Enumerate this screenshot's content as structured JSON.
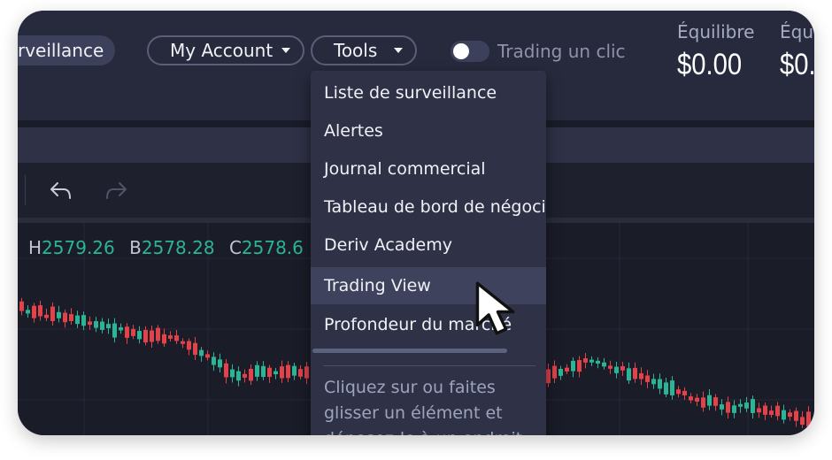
{
  "header": {
    "watchlist_label": "rveillance",
    "account_label": "My Account",
    "tools_label": "Tools",
    "toggle_label": "Trading un clic",
    "balances": [
      {
        "label": "Équilibre",
        "value": "$0.00"
      },
      {
        "label": "Équ",
        "value": "$0."
      }
    ]
  },
  "tools_menu": {
    "items": [
      {
        "label": "Liste de surveillance"
      },
      {
        "label": "Alertes"
      },
      {
        "label": "Journal commercial"
      },
      {
        "label": "Tableau de bord de négocia"
      },
      {
        "label": "Deriv Academy"
      },
      {
        "label": "Trading View"
      },
      {
        "label": "Profondeur du marché"
      }
    ],
    "hover_index": 5,
    "hint": "Cliquez sur ou faites glisser un élément et déposez-le à un endroit"
  },
  "chart": {
    "ohlc": [
      {
        "key": "H",
        "value": "2579.26"
      },
      {
        "key": "B",
        "value": "2578.28"
      },
      {
        "key": "C",
        "value": "2578.6"
      }
    ],
    "colors": {
      "up": "#2bb495",
      "down": "#e2424a",
      "grid": "#26293a"
    }
  }
}
